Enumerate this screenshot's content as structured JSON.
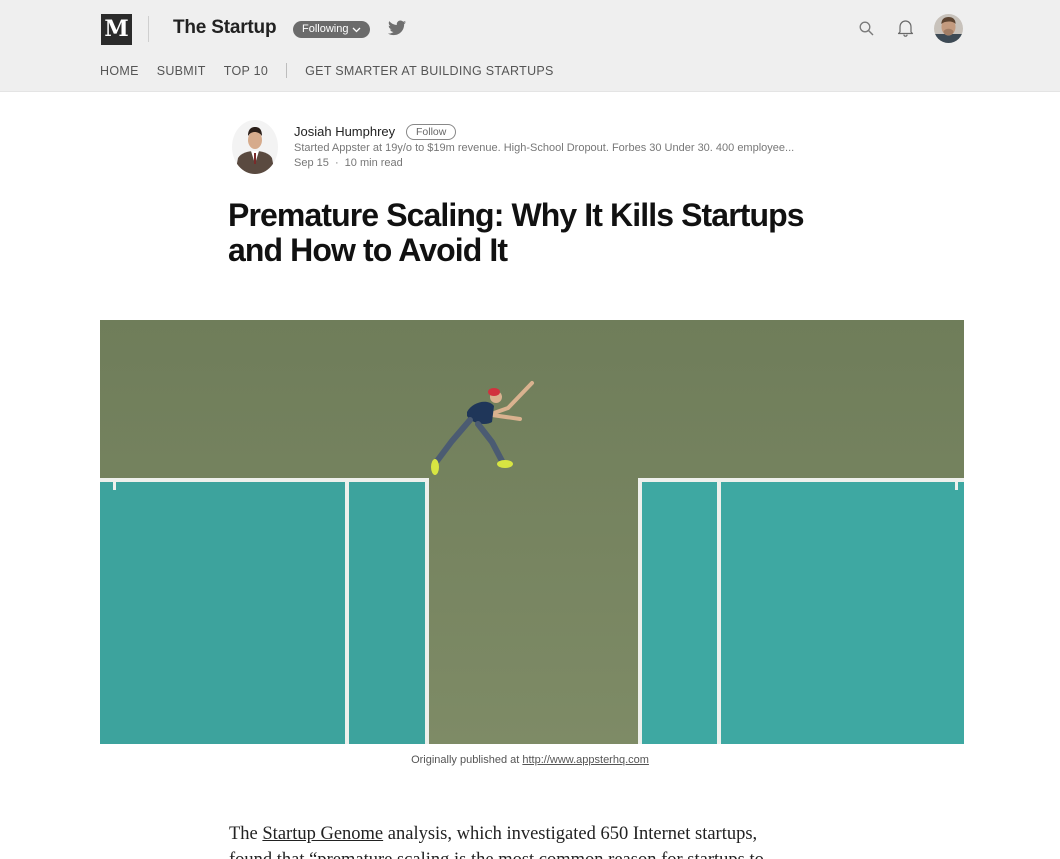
{
  "header": {
    "logo_letter": "M",
    "publication": "The Startup",
    "following_label": "Following",
    "icons": [
      "twitter-icon",
      "search-icon",
      "bell-icon",
      "user-avatar"
    ]
  },
  "nav": {
    "items": [
      "HOME",
      "SUBMIT",
      "TOP 10",
      "GET SMARTER AT BUILDING STARTUPS"
    ]
  },
  "author": {
    "name": "Josiah Humphrey",
    "follow_label": "Follow",
    "bio": "Started Appster at 19y/o to $19m revenue. High-School Dropout. Forbes 30 Under 30. 400 employee...",
    "date": "Sep 15",
    "separator": "·",
    "read_time": "10 min read"
  },
  "article": {
    "title_line1": "Premature Scaling: Why It Kills Startups",
    "title_line2": "and How to Avoid It",
    "caption_prefix": "Originally published at ",
    "caption_link": "http://www.appsterhq.com",
    "body_prefix": "The ",
    "body_link": "Startup Genome",
    "body_rest": " analysis, which investigated 650 Internet startups,",
    "body_line2": "found that “premature scaling is the most common reason for startups to"
  },
  "colors": {
    "header_bg": "#efefef",
    "court_green": "#7b8a63",
    "court_teal": "#3fa9a3",
    "court_line": "#f2f2f2"
  }
}
